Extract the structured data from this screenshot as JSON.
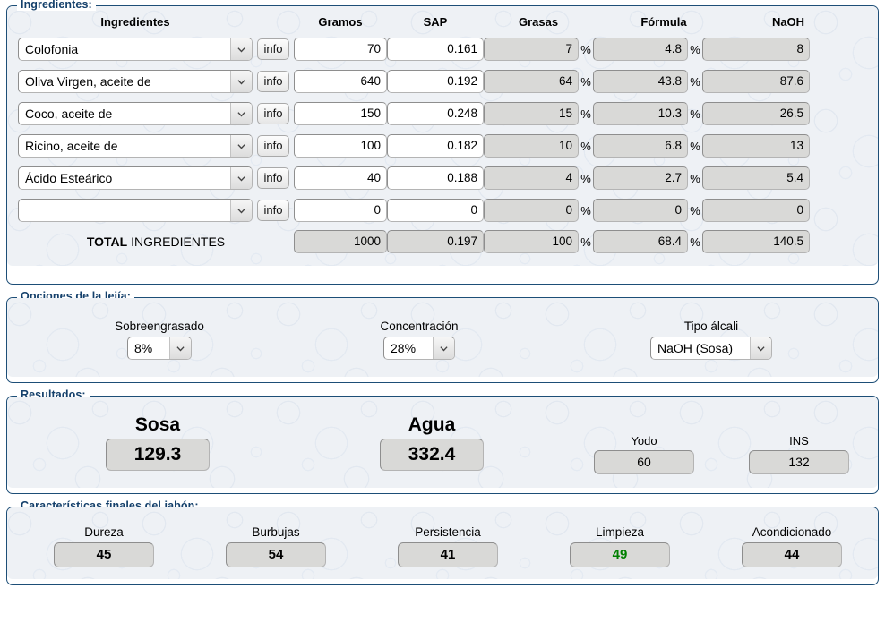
{
  "colors": {
    "legend": "#14406b",
    "panel_border": "#1d4e77",
    "highlight_green": "#008000",
    "readonly_bg": "#d9d9d7"
  },
  "ingredientes": {
    "legend": "Ingredientes:",
    "columns": {
      "name": "Ingredientes",
      "gramos": "Gramos",
      "sap": "SAP",
      "grasas": "Grasas",
      "formula": "Fórmula",
      "naoh": "NaOH"
    },
    "info_label": "info",
    "percent_symbol": "%",
    "rows": [
      {
        "name": "Colofonia",
        "gramos": "70",
        "sap": "0.161",
        "grasas": "7",
        "formula": "4.8",
        "naoh": "8"
      },
      {
        "name": "Oliva Virgen, aceite de",
        "gramos": "640",
        "sap": "0.192",
        "grasas": "64",
        "formula": "43.8",
        "naoh": "87.6"
      },
      {
        "name": "Coco, aceite de",
        "gramos": "150",
        "sap": "0.248",
        "grasas": "15",
        "formula": "10.3",
        "naoh": "26.5"
      },
      {
        "name": "Ricino, aceite de",
        "gramos": "100",
        "sap": "0.182",
        "grasas": "10",
        "formula": "6.8",
        "naoh": "13"
      },
      {
        "name": "Ácido Esteárico",
        "gramos": "40",
        "sap": "0.188",
        "grasas": "4",
        "formula": "2.7",
        "naoh": "5.4"
      },
      {
        "name": "",
        "gramos": "0",
        "sap": "0",
        "grasas": "0",
        "formula": "0",
        "naoh": "0"
      }
    ],
    "total": {
      "label_strong": "TOTAL",
      "label_rest": " INGREDIENTES",
      "gramos": "1000",
      "sap": "0.197",
      "grasas": "100",
      "formula": "68.4",
      "naoh": "140.5"
    }
  },
  "lejia": {
    "legend": "Opciones de la lejía:",
    "options": [
      {
        "label": "Sobreengrasado",
        "value": "8%"
      },
      {
        "label": "Concentración",
        "value": "28%"
      },
      {
        "label": "Tipo álcali",
        "value": "NaOH (Sosa)"
      }
    ]
  },
  "resultados": {
    "legend": "Resultados:",
    "items": [
      {
        "label": "Sosa",
        "value": "129.3",
        "size": "large"
      },
      {
        "label": "Agua",
        "value": "332.4",
        "size": "large"
      },
      {
        "label": "Yodo",
        "value": "60",
        "size": "small"
      },
      {
        "label": "INS",
        "value": "132",
        "size": "small"
      }
    ]
  },
  "caracteristicas": {
    "legend": "Características finales del jabón:",
    "items": [
      {
        "label": "Dureza",
        "value": "45",
        "color": "#000000"
      },
      {
        "label": "Burbujas",
        "value": "54",
        "color": "#000000"
      },
      {
        "label": "Persistencia",
        "value": "41",
        "color": "#000000"
      },
      {
        "label": "Limpieza",
        "value": "49",
        "color": "#008000"
      },
      {
        "label": "Acondicionado",
        "value": "44",
        "color": "#000000"
      }
    ]
  }
}
